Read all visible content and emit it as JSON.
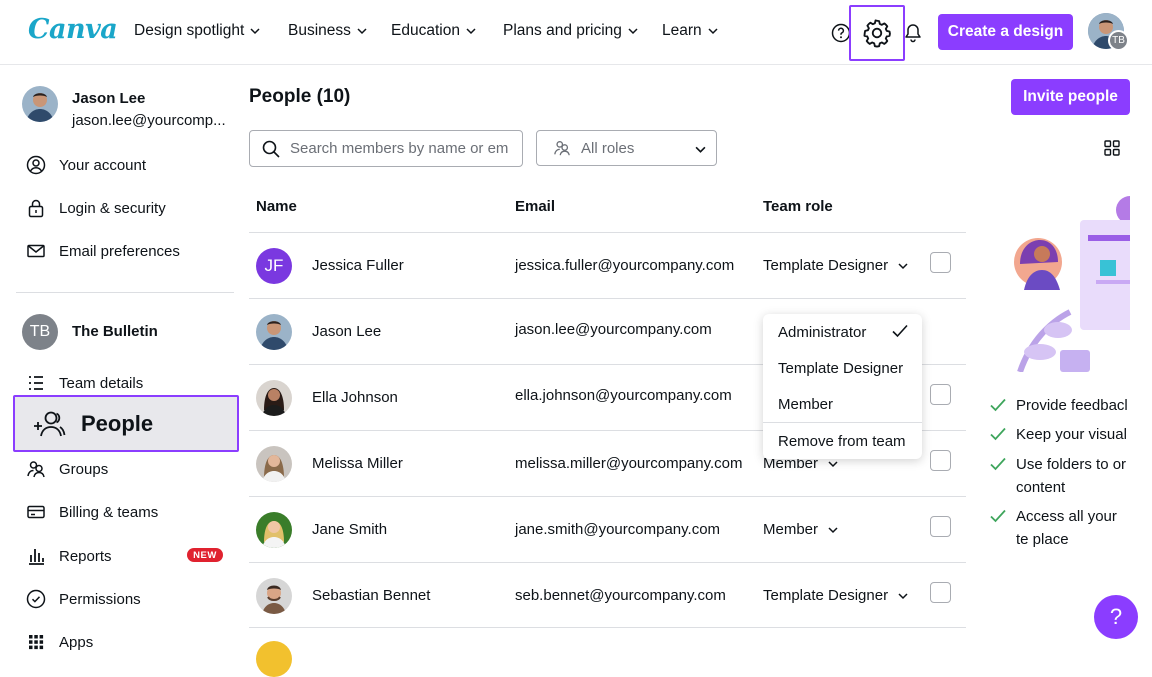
{
  "brand": {
    "logo_text": "Canva",
    "accent": "#8b3dff"
  },
  "topnav": {
    "items": [
      {
        "label": "Design spotlight"
      },
      {
        "label": "Business"
      },
      {
        "label": "Education"
      },
      {
        "label": "Plans and pricing"
      },
      {
        "label": "Learn"
      }
    ],
    "create_label": "Create a design",
    "avatar_initials": "TB"
  },
  "profile": {
    "name": "Jason Lee",
    "email": "jason.lee@yourcomp..."
  },
  "sidebar": {
    "account_items": [
      {
        "label": "Your account",
        "icon": "user-circle-icon"
      },
      {
        "label": "Login & security",
        "icon": "lock-icon"
      },
      {
        "label": "Email preferences",
        "icon": "mail-icon"
      }
    ],
    "team": {
      "initials": "TB",
      "name": "The Bulletin"
    },
    "team_items": [
      {
        "label": "Team details",
        "icon": "list-icon"
      },
      {
        "label": "People",
        "icon": "people-add-icon"
      },
      {
        "label": "Groups",
        "icon": "groups-icon"
      },
      {
        "label": "Billing & teams",
        "icon": "credit-card-icon"
      },
      {
        "label": "Reports",
        "icon": "bar-chart-icon",
        "badge": "NEW"
      },
      {
        "label": "Permissions",
        "icon": "check-circle-icon"
      },
      {
        "label": "Apps",
        "icon": "apps-grid-icon"
      }
    ]
  },
  "main": {
    "title": "People (10)",
    "invite_label": "Invite people",
    "search_placeholder": "Search members by name or em",
    "roles_filter": "All roles",
    "columns": {
      "name": "Name",
      "email": "Email",
      "role": "Team role"
    },
    "rows": [
      {
        "name": "Jessica Fuller",
        "email": "jessica.fuller@yourcompany.com",
        "role": "Template Designer",
        "initials": "JF"
      },
      {
        "name": "Jason Lee",
        "email": "jason.lee@yourcompany.com",
        "role": ""
      },
      {
        "name": "Ella Johnson",
        "email": "ella.johnson@yourcompany.com",
        "role": ""
      },
      {
        "name": "Melissa Miller",
        "email": "melissa.miller@yourcompany.com",
        "role": "Member"
      },
      {
        "name": "Jane Smith",
        "email": "jane.smith@yourcompany.com",
        "role": "Member"
      },
      {
        "name": "Sebastian Bennet",
        "email": "seb.bennet@yourcompany.com",
        "role": "Template Designer"
      }
    ]
  },
  "role_menu": {
    "options": [
      "Administrator",
      "Template Designer",
      "Member"
    ],
    "selected": "Administrator",
    "remove_label": "Remove from team"
  },
  "promo": {
    "items": [
      "Provide feedbacl",
      "Keep your visual",
      "Use folders to or content",
      "Access all your te place"
    ]
  },
  "help_label": "?"
}
